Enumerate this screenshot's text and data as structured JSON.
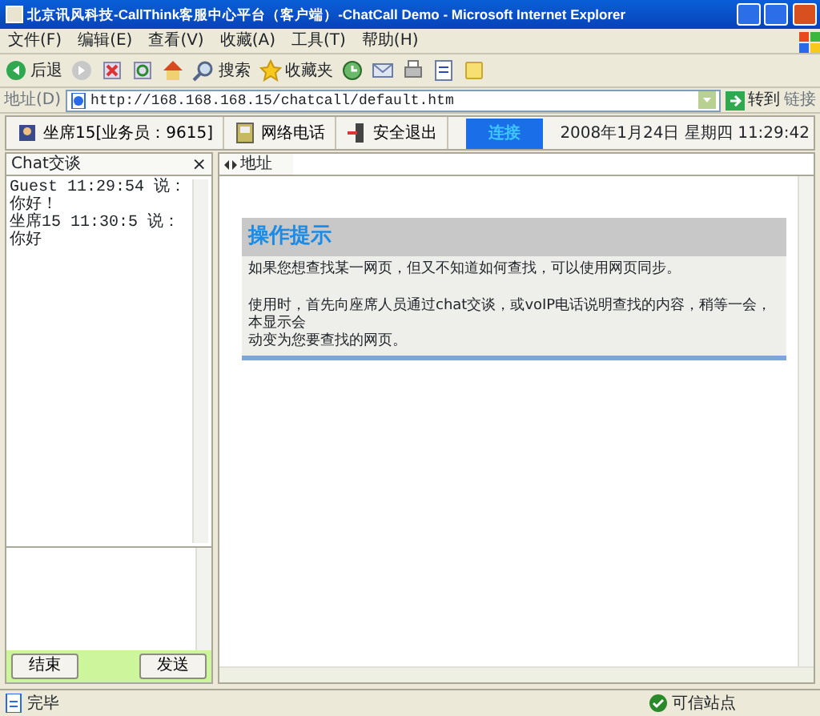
{
  "window": {
    "title": "北京讯风科技-CallThink客服中心平台（客户端）-ChatCall Demo - Microsoft Internet Explorer"
  },
  "menu": [
    "文件(F)",
    "编辑(E)",
    "查看(V)",
    "收藏(A)",
    "工具(T)",
    "帮助(H)"
  ],
  "toolbar": [
    {
      "kind": "back",
      "label": "后退"
    },
    {
      "kind": "forward"
    },
    {
      "kind": "stop"
    },
    {
      "kind": "refresh"
    },
    {
      "kind": "home"
    },
    {
      "kind": "search",
      "label": "搜索"
    },
    {
      "kind": "favorites",
      "label": "收藏夹"
    },
    {
      "kind": "history"
    },
    {
      "kind": "mail"
    },
    {
      "kind": "print"
    },
    {
      "kind": "edit"
    },
    {
      "kind": "note"
    }
  ],
  "address": {
    "label": "地址(D)",
    "url": "http://168.168.168.15/chatcall/default.htm",
    "go": "转到",
    "links": "链接"
  },
  "app_bar": {
    "items": [
      {
        "kind": "agent",
        "label": "坐席15[业务员：9615]"
      },
      {
        "kind": "phone",
        "label": "网络电话"
      },
      {
        "kind": "exit",
        "label": "安全退出"
      }
    ],
    "connect": "连接",
    "datetime": "2008年1月24日 星期四 11:29:42"
  },
  "chat": {
    "title": "Chat交谈",
    "close": "×",
    "messages": [
      "Guest 11:29:54 说：",
      "你好！",
      "坐席15 11:30:5 说：",
      "你好"
    ],
    "buttons": [
      "结束",
      "发送"
    ]
  },
  "content": {
    "address_label": "地址",
    "card_title": "操作提示",
    "paragraphs": [
      [
        "如果您想查找某一网页，但又不知道如何查找，可以使用网页同步。"
      ],
      [
        "使用时，首先向座席人员通过chat交谈，或voIP电话说明查找的内容，稍等一会，本显示会",
        "动变为您要查找的网页。"
      ]
    ]
  },
  "status": {
    "text": "完毕",
    "zone": "可信站点"
  }
}
